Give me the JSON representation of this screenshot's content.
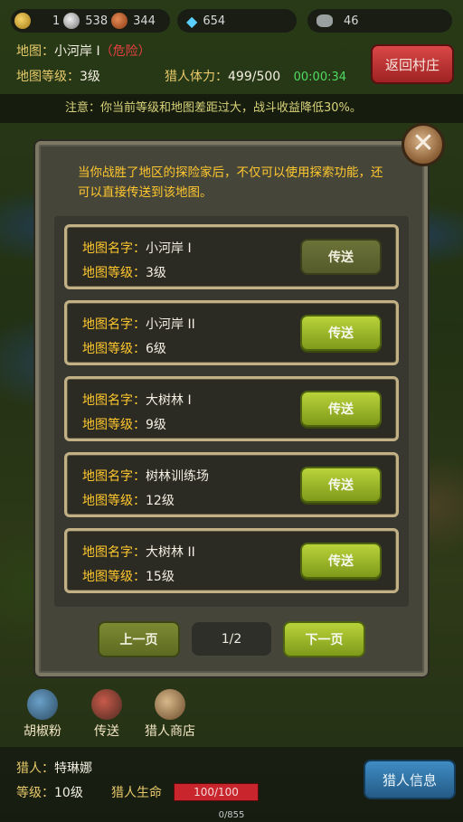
{
  "resources": {
    "gold": "1",
    "silver": "538",
    "copper": "344",
    "diamond": "654",
    "stone": "46"
  },
  "map_info": {
    "map_label": "地图：",
    "map_name": "小河岸 I",
    "danger_tag": "（危险）",
    "level_label": "地图等级：",
    "level_value": "3级",
    "stamina_label": "猎人体力：",
    "stamina_value": "499/500",
    "timer": "00:00:34",
    "back_button": "返回村庄"
  },
  "notice": "注意：你当前等级和地图差距过大，战斗收益降低30%。",
  "modal": {
    "intro": "当你战胜了地区的探险家后，不仅可以使用探索功能，还可以直接传送到该地图。",
    "name_label": "地图名字：",
    "level_label": "地图等级：",
    "maps": [
      {
        "name": "小河岸 I",
        "level": "3级",
        "button": "传送",
        "enabled": false
      },
      {
        "name": "小河岸 II",
        "level": "6级",
        "button": "传送",
        "enabled": true
      },
      {
        "name": "大树林 I",
        "level": "9级",
        "button": "传送",
        "enabled": true
      },
      {
        "name": "树林训练场",
        "level": "12级",
        "button": "传送",
        "enabled": true
      },
      {
        "name": "大树林 II",
        "level": "15级",
        "button": "传送",
        "enabled": true
      }
    ],
    "prev_button": "上一页",
    "page": "1/2",
    "next_button": "下一页",
    "close_glyph": "✕"
  },
  "tools": {
    "pepper": "胡椒粉",
    "teleport": "传送",
    "shop": "猎人商店"
  },
  "hunter": {
    "name_label": "猎人：",
    "name": "特琳娜",
    "level_label": "等级：",
    "level": "10级",
    "hp_label": "猎人生命",
    "hp": "100/100",
    "info_button": "猎人信息",
    "exp": "0/855"
  },
  "colors": {
    "label_gold": "#ffc82e",
    "button_green": "#9cbb2a",
    "danger_red": "#e84040",
    "timer_green": "#4fdc62"
  }
}
